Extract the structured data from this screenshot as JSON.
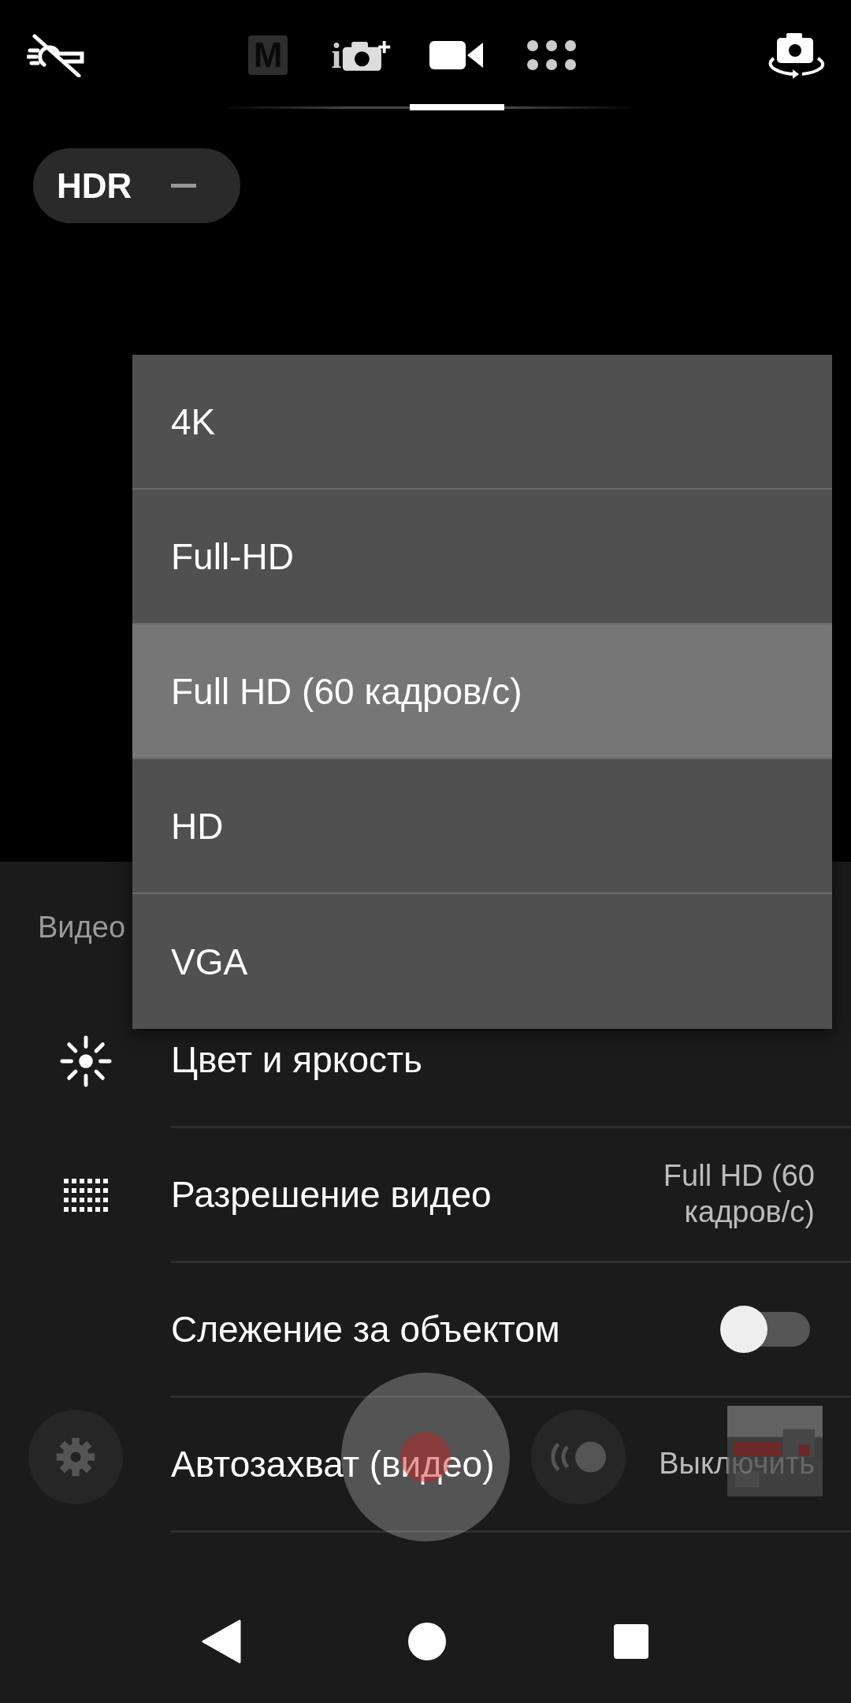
{
  "top_bar": {
    "modes": [
      {
        "kind": "manual",
        "label": "M",
        "selected": false
      },
      {
        "kind": "auto",
        "label": "i",
        "selected": false
      },
      {
        "kind": "video",
        "selected": true
      },
      {
        "kind": "apps",
        "selected": false
      }
    ]
  },
  "hdr": {
    "label": "HDR",
    "on": false
  },
  "settings": {
    "header": "Видео",
    "rows": [
      {
        "kind": "brightness",
        "label": "Цвет и яркость"
      },
      {
        "kind": "resolution",
        "label": "Разрешение видео",
        "value": "Full HD (60 кадров/с)"
      },
      {
        "kind": "toggle",
        "label": "Слежение за объектом",
        "on": false
      },
      {
        "kind": "value",
        "label": "Автозахват (видео)",
        "value": "Выключить"
      }
    ]
  },
  "dropdown": {
    "options": [
      {
        "label": "4K",
        "selected": false
      },
      {
        "label": "Full-HD",
        "selected": false
      },
      {
        "label": "Full HD (60 кадров/с)",
        "selected": true
      },
      {
        "label": "HD",
        "selected": false
      },
      {
        "label": "VGA",
        "selected": false
      }
    ]
  }
}
